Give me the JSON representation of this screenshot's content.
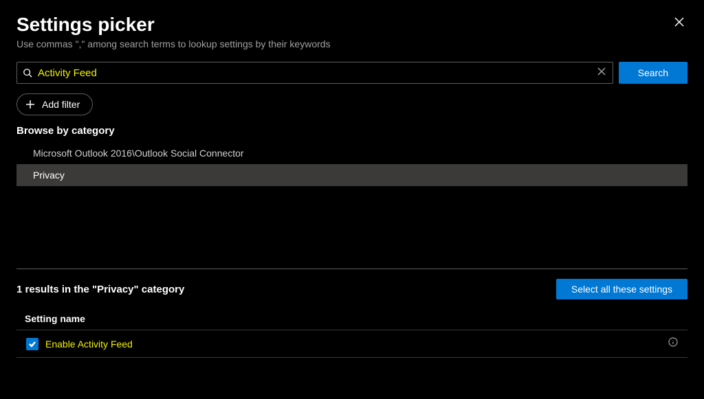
{
  "header": {
    "title": "Settings picker",
    "subtitle": "Use commas \",\" among search terms to lookup settings by their keywords"
  },
  "search": {
    "value": "Activity Feed",
    "placeholder": "",
    "button_label": "Search"
  },
  "add_filter_label": "Add filter",
  "browse_label": "Browse by category",
  "categories": [
    {
      "label": "Microsoft Outlook 2016\\Outlook Social Connector",
      "selected": false
    },
    {
      "label": "Privacy",
      "selected": true
    }
  ],
  "results": {
    "count_text": "1 results in the \"Privacy\" category",
    "select_all_label": "Select all these settings",
    "column_header": "Setting name",
    "items": [
      {
        "label": "Enable Activity Feed",
        "checked": true
      }
    ]
  }
}
